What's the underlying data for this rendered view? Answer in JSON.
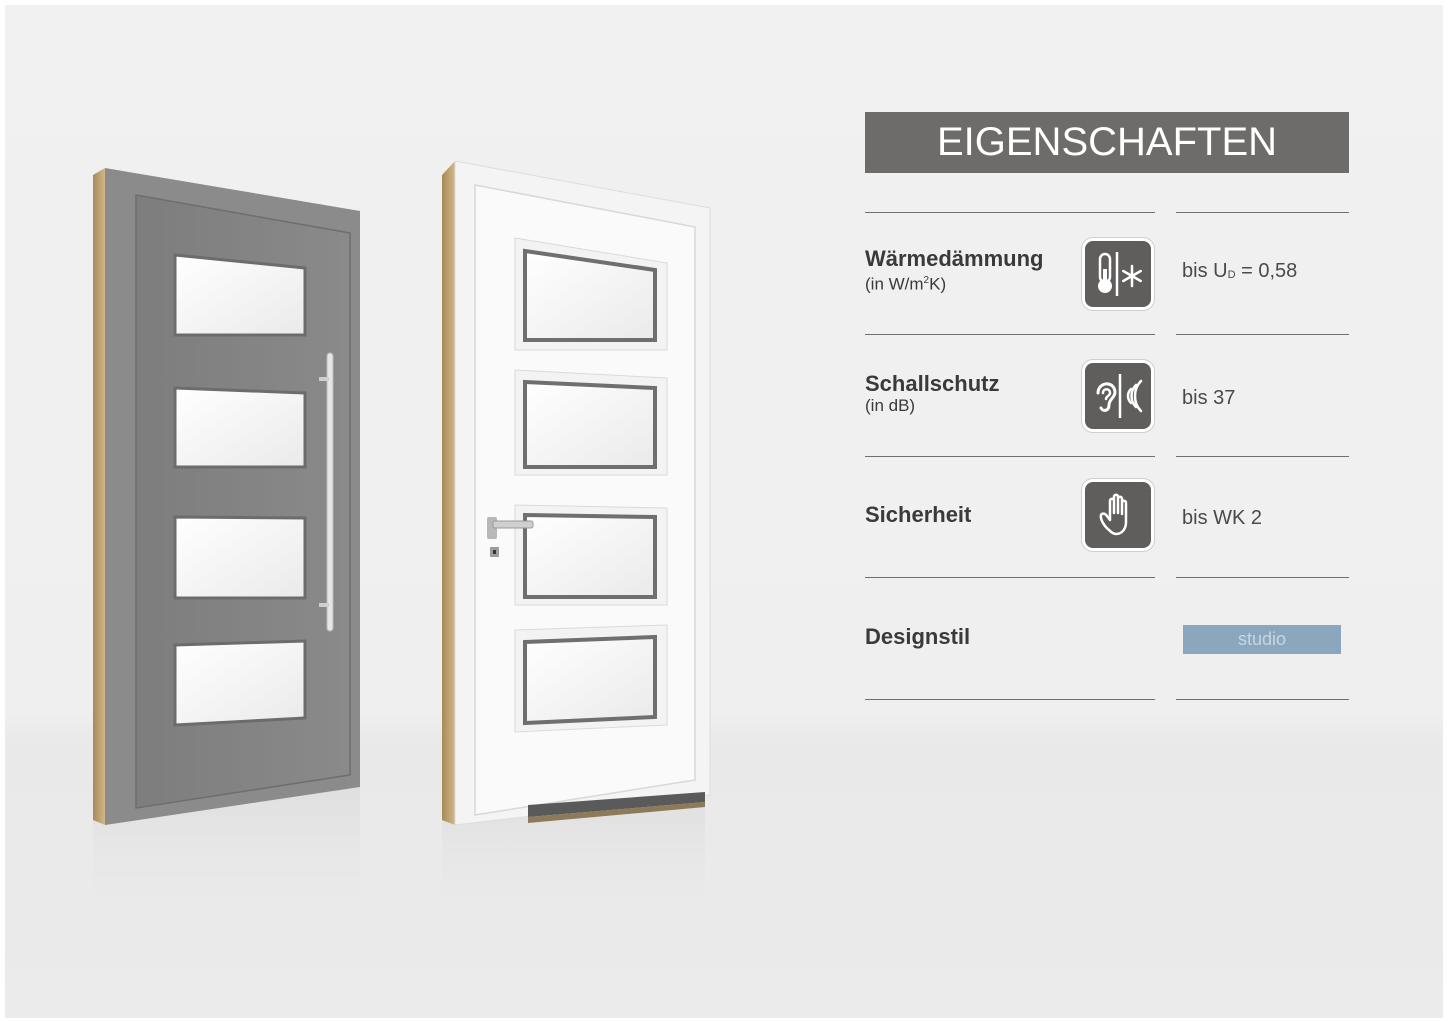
{
  "title": "EIGENSCHAFTEN",
  "rows": [
    {
      "label": "Wärmedämmung",
      "sub_prefix": "(in W/m",
      "sub_sup": "2",
      "sub_suffix": "K)",
      "value_prefix": "bis U",
      "value_sub": "D",
      "value_suffix": " = 0,58",
      "icon": "thermometer-snowflake-icon"
    },
    {
      "label": "Schallschutz",
      "sub": "(in dB)",
      "value": "bis 37",
      "icon": "ear-soundwave-icon"
    },
    {
      "label": "Sicherheit",
      "value": "bis WK 2",
      "icon": "hand-stop-icon"
    },
    {
      "label": "Designstil",
      "badge": "studio"
    }
  ],
  "colors": {
    "title_bar": "#6d6c6a",
    "icon_box": "#5f5e5c",
    "badge": "#8aa7bd",
    "door_grey": "#818181",
    "door_white": "#f6f6f6",
    "wood_edge": "#c4a77a"
  }
}
